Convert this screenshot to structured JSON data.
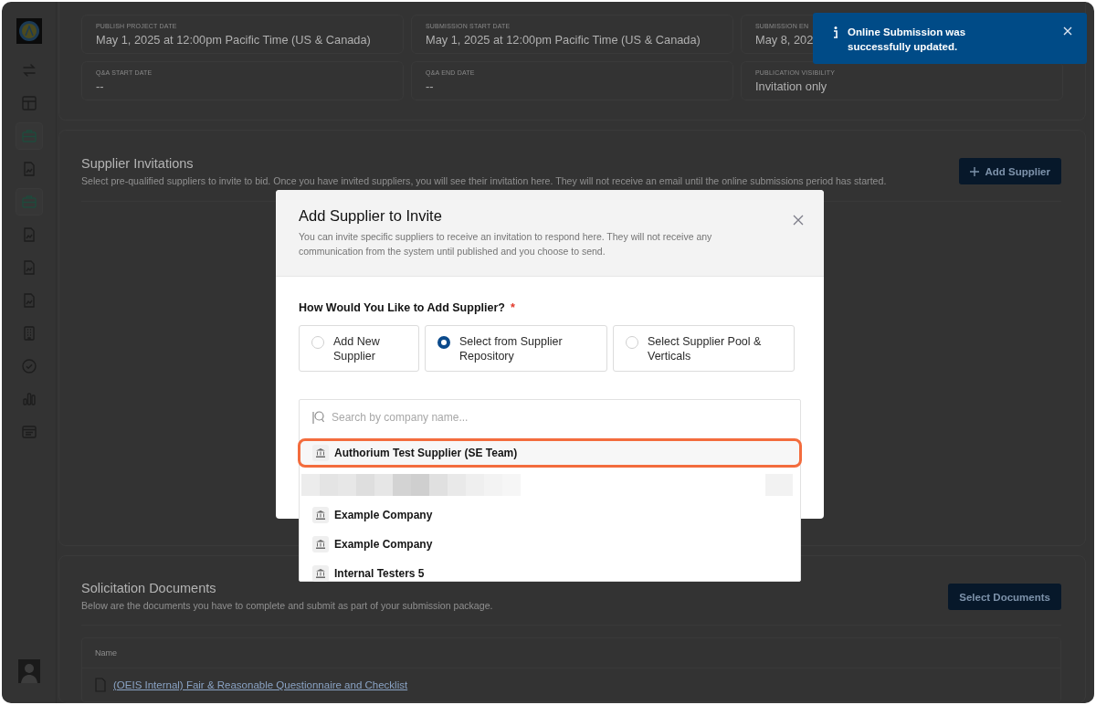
{
  "sidebar": {
    "items": [
      {
        "kind": "swap",
        "selected": false
      },
      {
        "kind": "layout",
        "selected": false
      },
      {
        "kind": "briefcase",
        "selected": true
      },
      {
        "kind": "document",
        "selected": false
      },
      {
        "kind": "briefcase",
        "selected": true
      },
      {
        "kind": "document",
        "selected": false
      },
      {
        "kind": "document",
        "selected": false
      },
      {
        "kind": "document",
        "selected": false
      },
      {
        "kind": "building",
        "selected": false
      },
      {
        "kind": "check",
        "selected": false
      },
      {
        "kind": "chart",
        "selected": false
      },
      {
        "kind": "list",
        "selected": false
      }
    ]
  },
  "schedule": {
    "fields": [
      {
        "label": "PUBLISH PROJECT DATE",
        "value": "May 1, 2025 at 12:00pm Pacific Time (US & Canada)"
      },
      {
        "label": "SUBMISSION START DATE",
        "value": "May 1, 2025 at 12:00pm Pacific Time (US & Canada)"
      },
      {
        "label": "SUBMISSION EN",
        "value": "May 8, 202"
      },
      {
        "label": "Q&A START DATE",
        "value": "--"
      },
      {
        "label": "Q&A END DATE",
        "value": "--"
      },
      {
        "label": "PUBLICATION VISIBILITY",
        "value": "Invitation only"
      }
    ]
  },
  "supplier_invitations": {
    "title": "Supplier Invitations",
    "description": "Select pre-qualified suppliers to invite to bid. Once you have invited suppliers, you will see their invitation here. They will not receive an email until the online submissions period has started.",
    "button": "Add Supplier"
  },
  "solicitation_documents": {
    "title": "Solicitation Documents",
    "description": "Below are the documents you have to complete and submit as part of your submission package.",
    "button": "Select Documents",
    "table": {
      "columns": [
        "Name"
      ],
      "rows": [
        {
          "name": "(OEIS Internal) Fair & Reasonable Questionnaire and Checklist"
        }
      ]
    }
  },
  "toast": {
    "message": "Online Submission was successfully updated."
  },
  "modal": {
    "title": "Add Supplier to Invite",
    "description": "You can invite specific suppliers to receive an invitation to respond here. They will not receive any communication from the system until published and you choose to send.",
    "question": "How Would You Like to Add Supplier?",
    "required_mark": "*",
    "options": [
      {
        "label": "Add New Supplier",
        "selected": false
      },
      {
        "label": "Select from Supplier Repository",
        "selected": true
      },
      {
        "label": "Select Supplier Pool & Verticals",
        "selected": false
      }
    ],
    "search": {
      "placeholder": "Search by company name..."
    },
    "suggestions": [
      {
        "kind": "company",
        "name": "Authorium Test Supplier (SE Team)",
        "selected": true
      },
      {
        "kind": "redacted",
        "selected": false
      },
      {
        "kind": "company",
        "name": "Example Company",
        "selected": false
      },
      {
        "kind": "company",
        "name": "Example Company",
        "selected": false
      },
      {
        "kind": "company",
        "name": "Internal Testers 5",
        "selected": false
      }
    ]
  }
}
